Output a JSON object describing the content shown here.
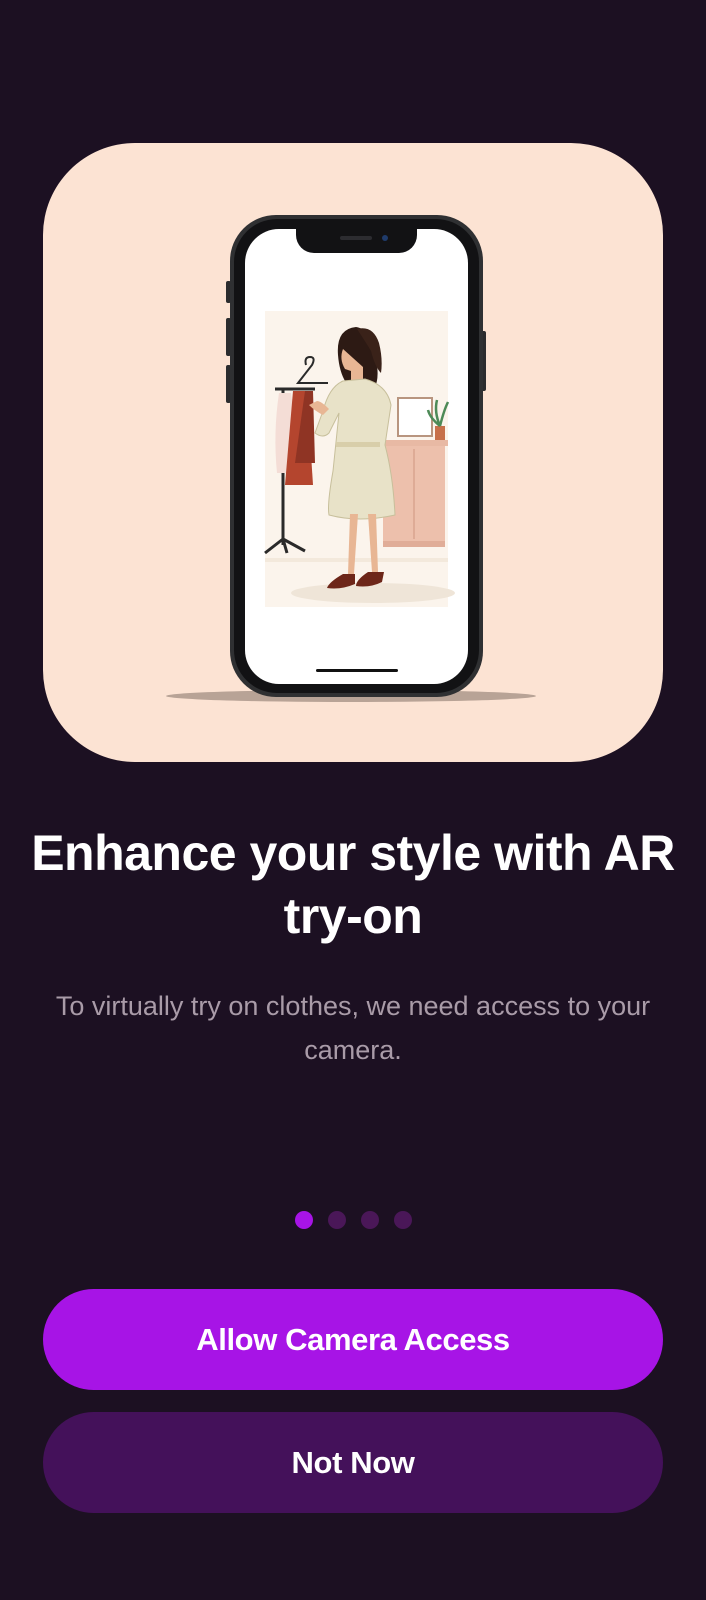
{
  "onboarding": {
    "title": "Enhance your style with AR try-on",
    "subtitle": "To virtually try on clothes, we need access to your camera.",
    "illustration": "phone-with-woman-trying-clothes",
    "pagination": {
      "total": 4,
      "current": 1
    }
  },
  "actions": {
    "primary_label": "Allow Camera Access",
    "secondary_label": "Not Now"
  },
  "colors": {
    "background": "#1c1022",
    "card_background": "#fce3d3",
    "accent": "#a714e6",
    "secondary_button": "#44115a",
    "dot_inactive": "#4a1758",
    "subtitle_text": "#a99ba8"
  }
}
